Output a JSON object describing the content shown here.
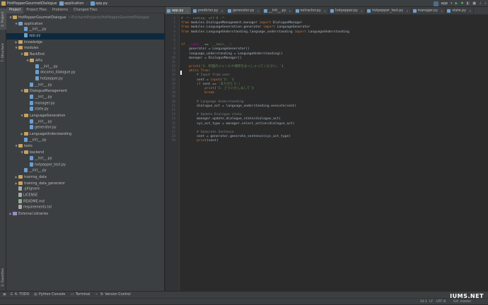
{
  "navbar": {
    "crumbs": [
      "HotPepperGourmetDialogue",
      "application",
      "app.py"
    ],
    "run_config": "app"
  },
  "left_strip": {
    "project": "1: Project",
    "structure": "7: Structure",
    "favorites": "2: Favorites"
  },
  "project_tabs": [
    "Project",
    "Project Files",
    "Problems",
    "Changed Files"
  ],
  "tree": [
    {
      "label": "HotPepperGourmetDialogue",
      "hint": "~/PycharmProjects/HotPepperGourmetDialogue",
      "indent": 0,
      "kind": "folder",
      "arrow": "▼"
    },
    {
      "label": "application",
      "indent": 1,
      "kind": "folder",
      "arrow": "▼"
    },
    {
      "label": "__init__.py",
      "indent": 2,
      "kind": "file"
    },
    {
      "label": "app.py",
      "indent": 2,
      "kind": "file",
      "selected": true
    },
    {
      "label": "knowledge",
      "indent": 1,
      "kind": "folder",
      "arrow": "▶"
    },
    {
      "label": "modules",
      "indent": 1,
      "kind": "folder",
      "arrow": "▼"
    },
    {
      "label": "BackEnd",
      "indent": 2,
      "kind": "folder",
      "arrow": "▼"
    },
    {
      "label": "APIs",
      "indent": 3,
      "kind": "folder",
      "arrow": "▼"
    },
    {
      "label": "__init__.py",
      "indent": 4,
      "kind": "file"
    },
    {
      "label": "docomo_dialogue.py",
      "indent": 4,
      "kind": "file"
    },
    {
      "label": "hotpepper.py",
      "indent": 4,
      "kind": "file"
    },
    {
      "label": "__init__.py",
      "indent": 3,
      "kind": "file"
    },
    {
      "label": "DialogueManagement",
      "indent": 2,
      "kind": "folder",
      "arrow": "▼"
    },
    {
      "label": "__init__.py",
      "indent": 3,
      "kind": "file"
    },
    {
      "label": "manager.py",
      "indent": 3,
      "kind": "file"
    },
    {
      "label": "state.py",
      "indent": 3,
      "kind": "file"
    },
    {
      "label": "LanguageGeneration",
      "indent": 2,
      "kind": "folder",
      "arrow": "▼"
    },
    {
      "label": "__init__.py",
      "indent": 3,
      "kind": "file"
    },
    {
      "label": "generator.py",
      "indent": 3,
      "kind": "file"
    },
    {
      "label": "LanguageUnderstanding",
      "indent": 2,
      "kind": "folder",
      "arrow": "▶"
    },
    {
      "label": "__init__.py",
      "indent": 2,
      "kind": "file"
    },
    {
      "label": "tests",
      "indent": 1,
      "kind": "folder",
      "arrow": "▼"
    },
    {
      "label": "backend",
      "indent": 2,
      "kind": "folder",
      "arrow": "▼"
    },
    {
      "label": "__init__.py",
      "indent": 3,
      "kind": "file"
    },
    {
      "label": "hotpepper_test.py",
      "indent": 3,
      "kind": "file"
    },
    {
      "label": "__init__.py",
      "indent": 2,
      "kind": "file"
    },
    {
      "label": "training_data",
      "indent": 1,
      "kind": "folder",
      "arrow": "▶"
    },
    {
      "label": "training_data_generator",
      "indent": 1,
      "kind": "folder",
      "arrow": "▶"
    },
    {
      "label": ".gitignore",
      "indent": 1,
      "kind": "txt"
    },
    {
      "label": "LICENSE",
      "indent": 1,
      "kind": "txt"
    },
    {
      "label": "README.md",
      "indent": 1,
      "kind": "md"
    },
    {
      "label": "requirements.txt",
      "indent": 1,
      "kind": "txt"
    },
    {
      "label": "External Libraries",
      "indent": 0,
      "kind": "lib",
      "arrow": "▶"
    }
  ],
  "editor_tabs": [
    {
      "label": "app.py",
      "active": true
    },
    {
      "label": "predictor.py"
    },
    {
      "label": "generator.py"
    },
    {
      "label": "__init__.py"
    },
    {
      "label": "extractor.py"
    },
    {
      "label": "hotpepper.py"
    },
    {
      "label": "hotpepper_test.py"
    },
    {
      "label": "manager.py"
    },
    {
      "label": "state.py"
    }
  ],
  "code": [
    [
      [
        "cm",
        "# -*- coding: utf-8 -*-"
      ]
    ],
    [
      [
        "kw",
        "from "
      ],
      [
        "",
        "modules.DialogueManagement.manager "
      ],
      [
        "kw",
        "import "
      ],
      [
        "",
        "DialogueManager"
      ]
    ],
    [
      [
        "kw",
        "from "
      ],
      [
        "",
        "modules.LanguageGeneration.generator "
      ],
      [
        "kw",
        "import "
      ],
      [
        "",
        "LanguageGenerator"
      ]
    ],
    [
      [
        "kw",
        "from "
      ],
      [
        "",
        "modules.LanguageUnderstanding.language_understanding "
      ],
      [
        "kw",
        "import "
      ],
      [
        "",
        "LanguageUnderstanding"
      ]
    ],
    [],
    [],
    [
      [
        "kw",
        "if "
      ],
      [
        "mg",
        "__name__"
      ],
      [
        "",
        " == "
      ],
      [
        "st",
        "'__main__'"
      ],
      [
        "",
        ":"
      ]
    ],
    [
      [
        "",
        "    generator = LanguageGenerator()"
      ]
    ],
    [
      [
        "",
        "    language_understanding = LanguageUnderstanding()"
      ]
    ],
    [
      [
        "",
        "    manager = DialogueManager()"
      ]
    ],
    [],
    [
      [
        "",
        "    "
      ],
      [
        "kw",
        "print"
      ],
      [
        "",
        "("
      ],
      [
        "st",
        "'S: 料理のジャンルや場所をおっしゃってください。'"
      ],
      [
        "",
        ")"
      ]
    ],
    [
      [
        "",
        "    "
      ],
      [
        "kw",
        "while "
      ],
      [
        "kw",
        "True"
      ],
      [
        "",
        ":"
      ]
    ],
    [
      [
        "",
        "        "
      ],
      [
        "cm",
        "# Input from user"
      ]
    ],
    [
      [
        "",
        "        sent = "
      ],
      [
        "kw",
        "input"
      ],
      [
        "",
        "("
      ],
      [
        "st",
        "'U: '"
      ],
      [
        "",
        ")"
      ]
    ],
    [
      [
        "",
        "        "
      ],
      [
        "kw",
        "if "
      ],
      [
        "",
        "sent == "
      ],
      [
        "st",
        "'ありがとう'"
      ],
      [
        "",
        ":"
      ]
    ],
    [
      [
        "",
        "            "
      ],
      [
        "kw",
        "print"
      ],
      [
        "",
        "("
      ],
      [
        "st",
        "'S: どういたしまして'"
      ],
      [
        "",
        ")"
      ]
    ],
    [
      [
        "",
        "            "
      ],
      [
        "kw",
        "break"
      ]
    ],
    [],
    [
      [
        "",
        "        "
      ],
      [
        "cm",
        "# Language Understanding"
      ]
    ],
    [
      [
        "",
        "        dialogue_act = language_understanding.execute(sent)"
      ]
    ],
    [],
    [
      [
        "",
        "        "
      ],
      [
        "cm",
        "# Update Dialogue state"
      ]
    ],
    [
      [
        "",
        "        manager.update_dialogue_state(dialogue_act)"
      ]
    ],
    [
      [
        "",
        "        sys_act_type = manager.select_action(dialogue_act)"
      ]
    ],
    [],
    [
      [
        "",
        "        "
      ],
      [
        "cm",
        "# Generate Sentence"
      ]
    ],
    [
      [
        "",
        "        sent = generator.generate_sentence(sys_act_type)"
      ]
    ],
    [
      [
        "",
        "        "
      ],
      [
        "kw",
        "print"
      ],
      [
        "",
        "(sent)"
      ]
    ]
  ],
  "bottom_tools": [
    "6: TODO",
    "Python Console",
    "Terminal",
    "9: Version Control"
  ],
  "status": {
    "position": "14:1",
    "line_sep": "LF",
    "encoding": "UTF-8",
    "vcs": "Git: master"
  },
  "watermark": "IUMS.NET",
  "colors": {
    "keyword": "#cc7832",
    "comment": "#808080",
    "string": "#6a8759",
    "selection": "#0d293e"
  }
}
